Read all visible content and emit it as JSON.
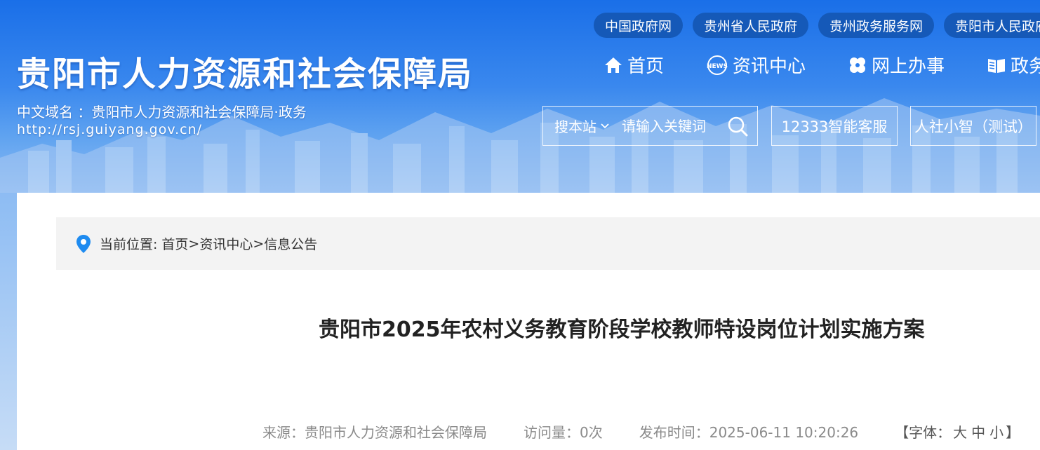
{
  "header": {
    "site_title": "贵阳市人力资源和社会保障局",
    "domain_label": "中文域名 ：贵阳市人力资源和社会保障局·政务",
    "url_text": "http://rsj.guiyang.gov.cn/"
  },
  "gov_links": [
    {
      "label": "中国政府网"
    },
    {
      "label": "贵州省人民政府"
    },
    {
      "label": "贵州政务服务网"
    },
    {
      "label": "贵阳市人民政府"
    }
  ],
  "nav": {
    "items": [
      {
        "label": "首页",
        "icon": "home-icon"
      },
      {
        "label": "资讯中心",
        "icon": "news-icon"
      },
      {
        "label": "网上办事",
        "icon": "service-icon"
      },
      {
        "label": "政务公开",
        "icon": "book-icon"
      }
    ]
  },
  "search": {
    "scope_label": "搜本站",
    "placeholder": "请输入关键词"
  },
  "services": {
    "hotline_label": "12333智能客服",
    "assistant_label": "人社小智（测试）"
  },
  "breadcrumb": {
    "prefix": "当前位置:",
    "items": [
      "首页",
      "资讯中心",
      "信息公告"
    ],
    "separator": ">"
  },
  "article": {
    "title": "贵阳市2025年农村义务教育阶段学校教师特设岗位计划实施方案",
    "source": "来源：贵阳市人力资源和社会保障局",
    "views": "访问量：0次",
    "publish_time": "发布时间：2025-06-11 10:20:26",
    "font_label_open": "【字体：",
    "font_large": "大",
    "font_medium": "中",
    "font_small": "小",
    "font_label_close": "】"
  },
  "colors": {
    "banner": "#1a6fe8",
    "pill": "#1559b8",
    "breadcrumb_bg": "#f3f3f3",
    "pin": "#1e8bf0"
  }
}
